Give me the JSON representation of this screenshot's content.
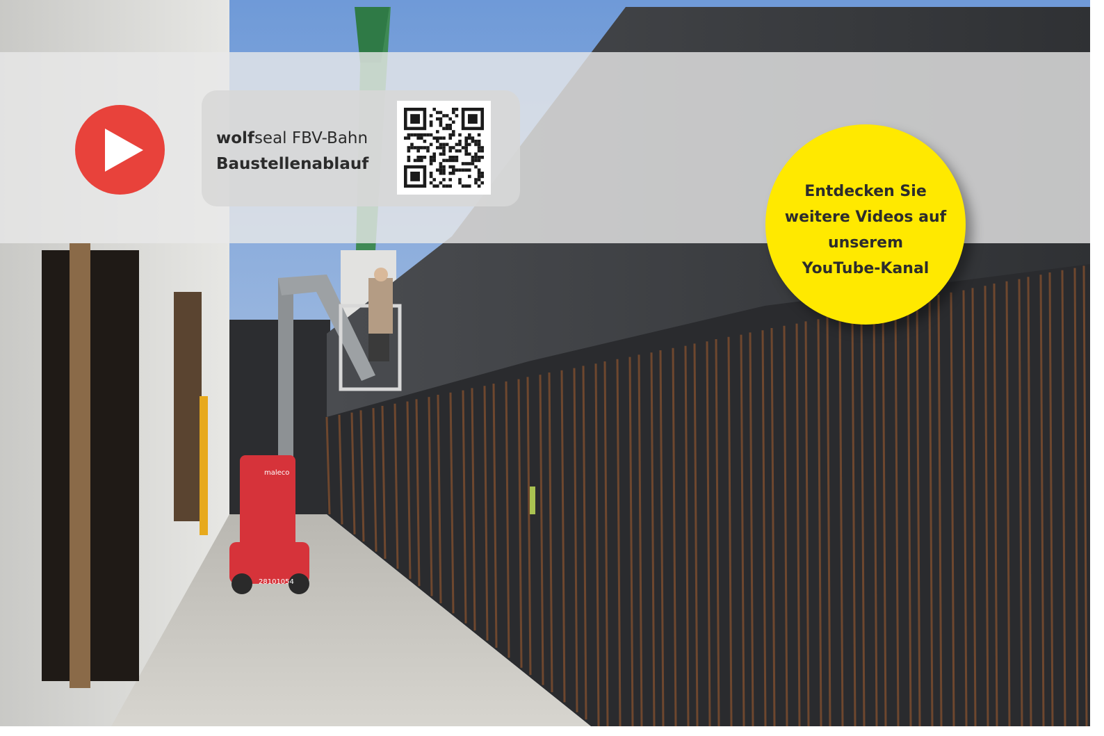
{
  "video_card": {
    "brand_bold": "wolf",
    "brand_rest": "seal FBV-Bahn",
    "subtitle": "Baustellenablauf"
  },
  "badge": {
    "line1": "Entdecken Sie",
    "line2": "weitere Videos auf",
    "line3": "unserem",
    "line4": "YouTube-Kanal"
  },
  "photo": {
    "lift_label": "maleco",
    "lift_number": "28101054"
  },
  "icons": {
    "play": "youtube-play-icon",
    "qr": "qr-code-icon"
  },
  "colors": {
    "play_red": "#e8423b",
    "badge_yellow": "#ffe900",
    "banner_grey": "#e8e8e8"
  }
}
